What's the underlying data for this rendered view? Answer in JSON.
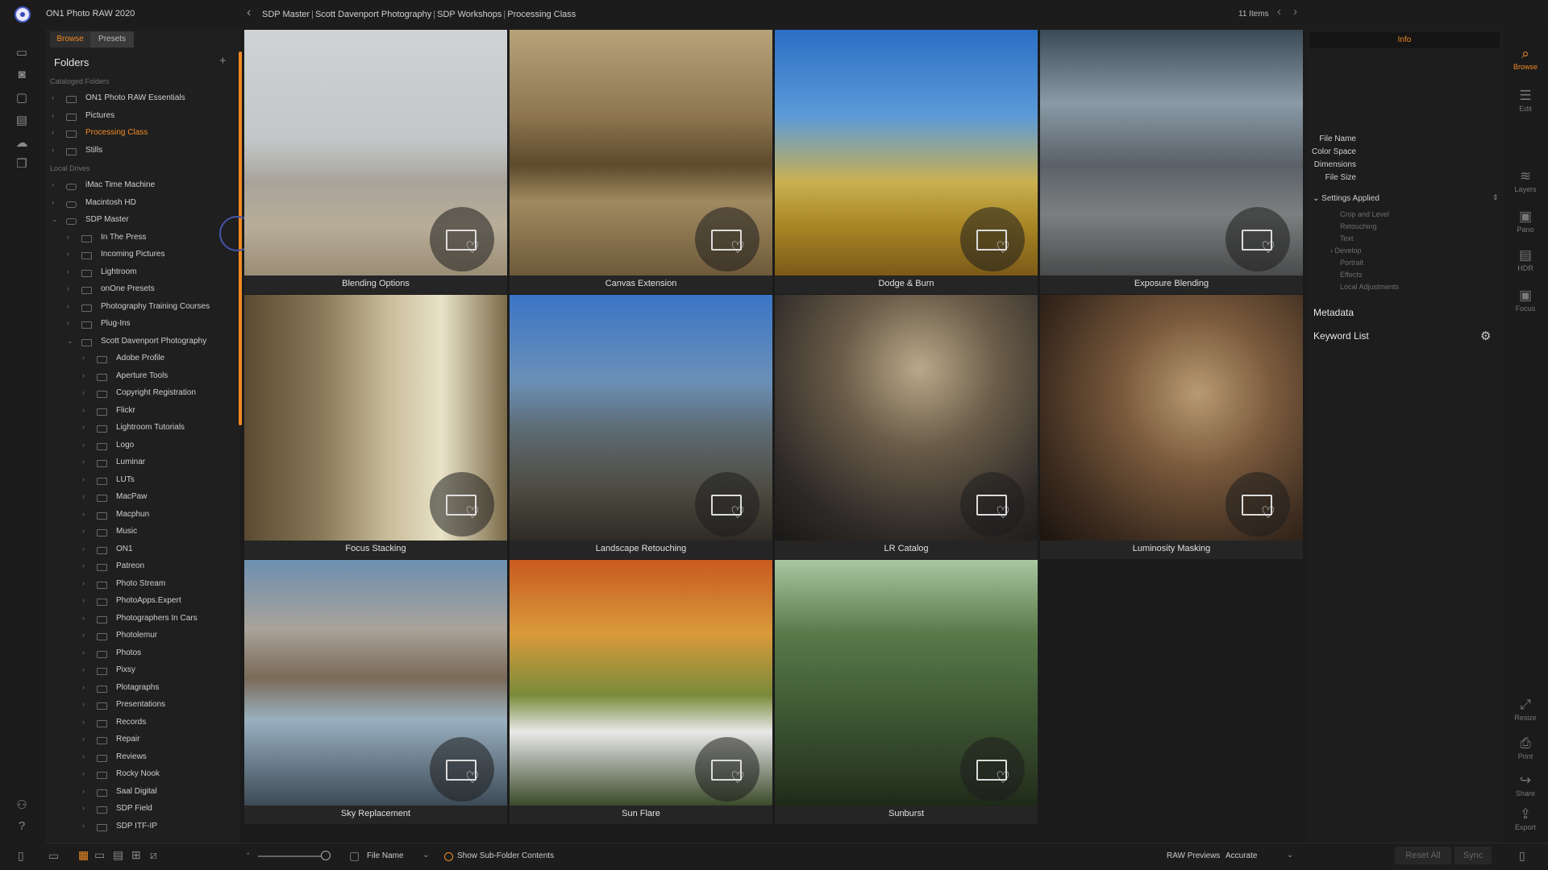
{
  "app": {
    "title": "ON1 Photo RAW 2020"
  },
  "breadcrumb": [
    "SDP Master",
    "Scott Davenport Photography",
    "SDP Workshops",
    "Processing Class"
  ],
  "item_count": "11 Items",
  "tabs": {
    "browse": "Browse",
    "presets": "Presets"
  },
  "folders": {
    "title": "Folders",
    "cataloged_label": "Cataloged Folders",
    "cataloged": [
      "ON1 Photo RAW Essentials",
      "Pictures",
      "Processing Class",
      "Stills"
    ],
    "local_label": "Local Drives",
    "drives": [
      "iMac Time Machine",
      "Macintosh HD",
      "SDP Master"
    ],
    "sdp_master_children": [
      "In The Press",
      "Incoming Pictures",
      "Lightroom",
      "onOne Presets",
      "Photography Training Courses",
      "Plug-Ins",
      "Scott Davenport Photography"
    ],
    "sdp_children": [
      "Adobe Profile",
      "Aperture Tools",
      "Copyright Registration",
      "Flickr",
      "Lightroom Tutorials",
      "Logo",
      "Luminar",
      "LUTs",
      "MacPaw",
      "Macphun",
      "Music",
      "ON1",
      "Patreon",
      "Photo Stream",
      "PhotoApps.Expert",
      "Photographers In Cars",
      "Photolemur",
      "Photos",
      "Pixsy",
      "Plotagraphs",
      "Presentations",
      "Records",
      "Repair",
      "Reviews",
      "Rocky Nook",
      "Saal Digital",
      "SDP Field",
      "SDP ITF-IP"
    ]
  },
  "grid": [
    {
      "caption": "Blending Options"
    },
    {
      "caption": "Canvas Extension"
    },
    {
      "caption": "Dodge & Burn"
    },
    {
      "caption": "Exposure Blending"
    },
    {
      "caption": "Focus Stacking"
    },
    {
      "caption": "Landscape Retouching"
    },
    {
      "caption": "LR Catalog"
    },
    {
      "caption": "Luminosity Masking"
    },
    {
      "caption": "Sky Replacement"
    },
    {
      "caption": "Sun Flare"
    },
    {
      "caption": "Sunburst"
    }
  ],
  "info": {
    "tab": "Info",
    "fields": [
      "File Name",
      "Color Space",
      "Dimensions",
      "File Size"
    ],
    "settings_applied": "Settings Applied",
    "settings": [
      "Crop and Level",
      "Retouching",
      "Text",
      "Develop",
      "Portrait",
      "Effects",
      "Local Adjustments"
    ],
    "metadata": "Metadata",
    "keyword_list": "Keyword List"
  },
  "right_tools": [
    "Browse",
    "Edit",
    "Layers",
    "Pano",
    "HDR",
    "Focus",
    "Resize",
    "Print",
    "Share",
    "Export"
  ],
  "bottom": {
    "sort_by": "File Name",
    "show_subfolders": "Show Sub-Folder Contents",
    "raw_previews_label": "RAW Previews",
    "raw_previews_value": "Accurate",
    "reset_all": "Reset All",
    "sync": "Sync"
  },
  "colors": {
    "accent": "#f08a24",
    "background": "#1b1b1b",
    "panel": "#1f1f1f"
  }
}
